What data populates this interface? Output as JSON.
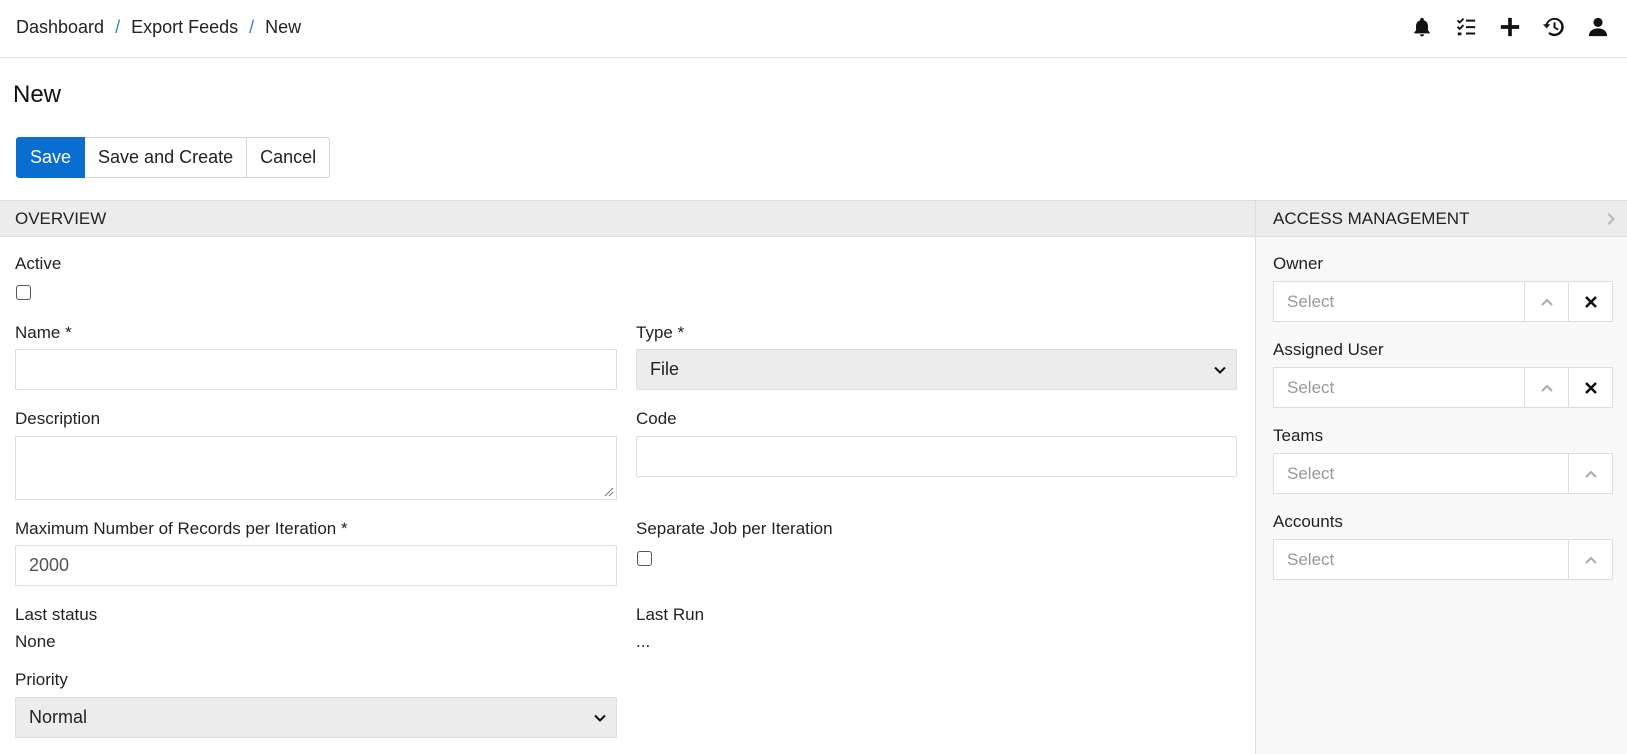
{
  "breadcrumb": {
    "items": [
      "Dashboard",
      "Export Feeds",
      "New"
    ],
    "separator": "/"
  },
  "page": {
    "title": "New"
  },
  "actions": {
    "save": "Save",
    "save_and_create": "Save and Create",
    "cancel": "Cancel"
  },
  "overview": {
    "heading": "OVERVIEW",
    "active_label": "Active",
    "name_label": "Name *",
    "name_value": "",
    "type_label": "Type *",
    "type_value": "File",
    "description_label": "Description",
    "code_label": "Code",
    "max_records_label": "Maximum Number of Records per Iteration *",
    "max_records_value": "2000",
    "separate_job_label": "Separate Job per Iteration",
    "last_status_label": "Last status",
    "last_status_value": "None",
    "last_run_label": "Last Run",
    "last_run_value": "...",
    "priority_label": "Priority",
    "priority_value": "Normal"
  },
  "access": {
    "heading": "ACCESS MANAGEMENT",
    "owner_label": "Owner",
    "owner_placeholder": "Select",
    "assigned_label": "Assigned User",
    "assigned_placeholder": "Select",
    "teams_label": "Teams",
    "teams_placeholder": "Select",
    "accounts_label": "Accounts",
    "accounts_placeholder": "Select"
  },
  "colors": {
    "primary": "#0a6ed1",
    "link_separator": "#3a7bd5",
    "panel_header": "#ececec"
  },
  "icons": [
    "bell-icon",
    "checklist-icon",
    "plus-icon",
    "history-icon",
    "user-icon"
  ]
}
